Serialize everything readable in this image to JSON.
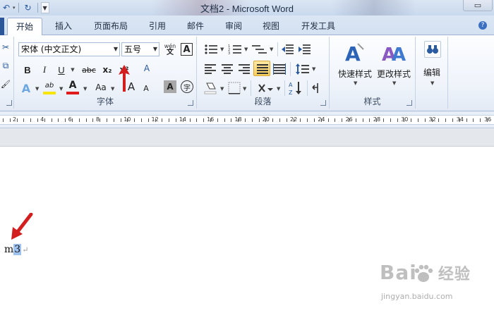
{
  "window": {
    "title": "文档2 - Microsoft Word",
    "controls_glyph": "▭"
  },
  "quick_access": {
    "undo_glyph": "↶",
    "redo_glyph": "↻",
    "more_glyph": "▼"
  },
  "tabs": [
    {
      "label": "开始",
      "active": true
    },
    {
      "label": "插入"
    },
    {
      "label": "页面布局"
    },
    {
      "label": "引用"
    },
    {
      "label": "邮件"
    },
    {
      "label": "审阅"
    },
    {
      "label": "视图"
    },
    {
      "label": "开发工具"
    }
  ],
  "help_glyph": "?",
  "ribbon": {
    "clipboard": {
      "cut_glyph": "✂",
      "copy_glyph": "⧉",
      "paint_glyph": "🖌"
    },
    "font": {
      "font_name": "宋体 (中文正文)",
      "font_size": "五号",
      "wen_glyph": "wén",
      "a_box_glyph": "A",
      "bold": "B",
      "italic": "I",
      "underline": "U",
      "strike": "abc",
      "subscript": "x₂",
      "superscript": "x²",
      "clear_format_glyph": "A",
      "text_effect_glyph": "A",
      "highlight_glyph": "ab",
      "font_color_glyph": "A",
      "change_case": "Aa",
      "grow_font": "A",
      "shrink_font": "A",
      "char_shade": "A",
      "enclose": "字",
      "label": "字体"
    },
    "paragraph": {
      "label": "段落"
    },
    "styles": {
      "quick_styles": "快速样式",
      "change_styles": "更改样式",
      "label": "样式"
    },
    "editing": {
      "label": "编辑",
      "find_glyph": "🔍"
    }
  },
  "ruler": {
    "numbers": [
      "2",
      "4",
      "6",
      "8",
      "10",
      "12",
      "14",
      "16",
      "18",
      "20",
      "22",
      "24",
      "26",
      "28",
      "30",
      "32",
      "34",
      "36"
    ]
  },
  "document": {
    "text_before": "m",
    "selected_text": "3",
    "paragraph_mark": "↵"
  },
  "watermark": {
    "brand_prefix": "Bai",
    "brand_suffix": "经验",
    "site": "jingyan.baidu.com"
  },
  "colors": {
    "accent_red": "#d21e1e",
    "selection": "#9ec3f0",
    "font_color_bar": "#e01b1b",
    "highlight_bar": "#f7e600"
  }
}
